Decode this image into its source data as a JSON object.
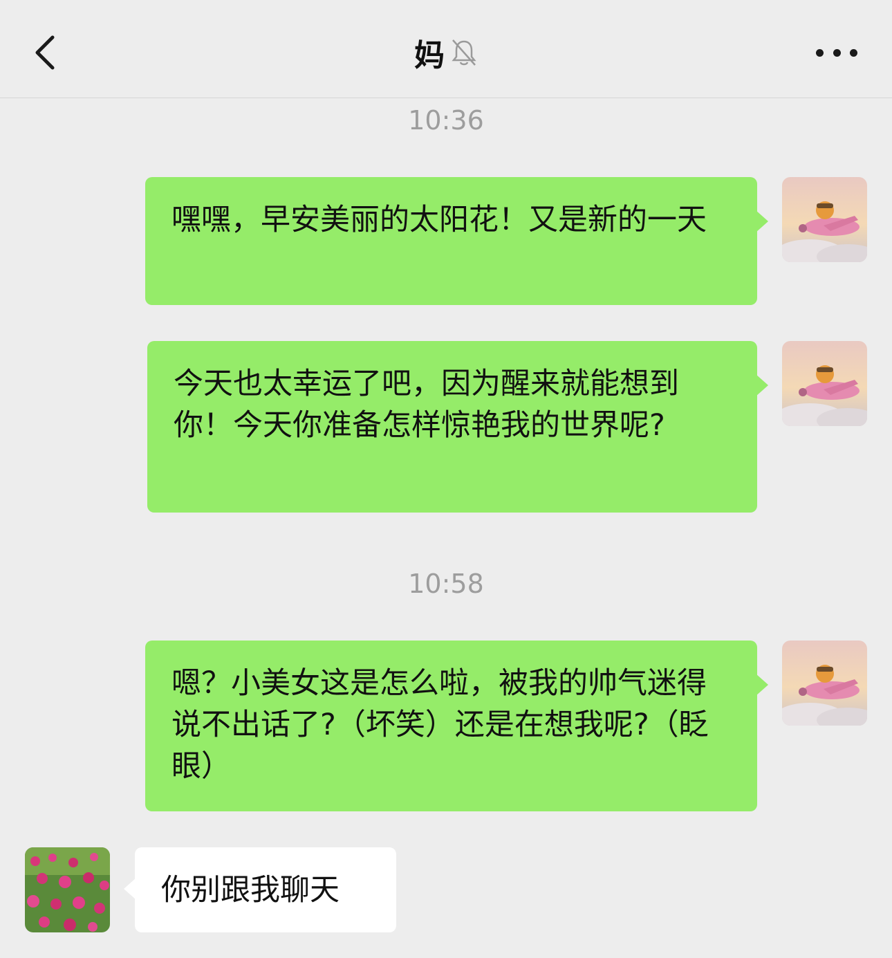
{
  "header": {
    "title": "妈",
    "back_icon": "chevron-left-icon",
    "mute_icon": "bell-muted-icon",
    "more_icon": "more-dots-icon"
  },
  "messages": {
    "time1": "10:36",
    "msg1": "嘿嘿，早安美丽的太阳花！又是新的一天",
    "msg2": "今天也太幸运了吧，因为醒来就能想到你！今天你准备怎样惊艳我的世界呢?",
    "time2": "10:58",
    "msg3": "嗯？小美女这是怎么啦，被我的帅气迷得说不出话了?（坏笑）还是在想我呢?（眨眼）",
    "msg4": "你别跟我聊天"
  },
  "colors": {
    "outgoing_bubble": "#95ec69",
    "incoming_bubble": "#ffffff",
    "background": "#ededed"
  }
}
